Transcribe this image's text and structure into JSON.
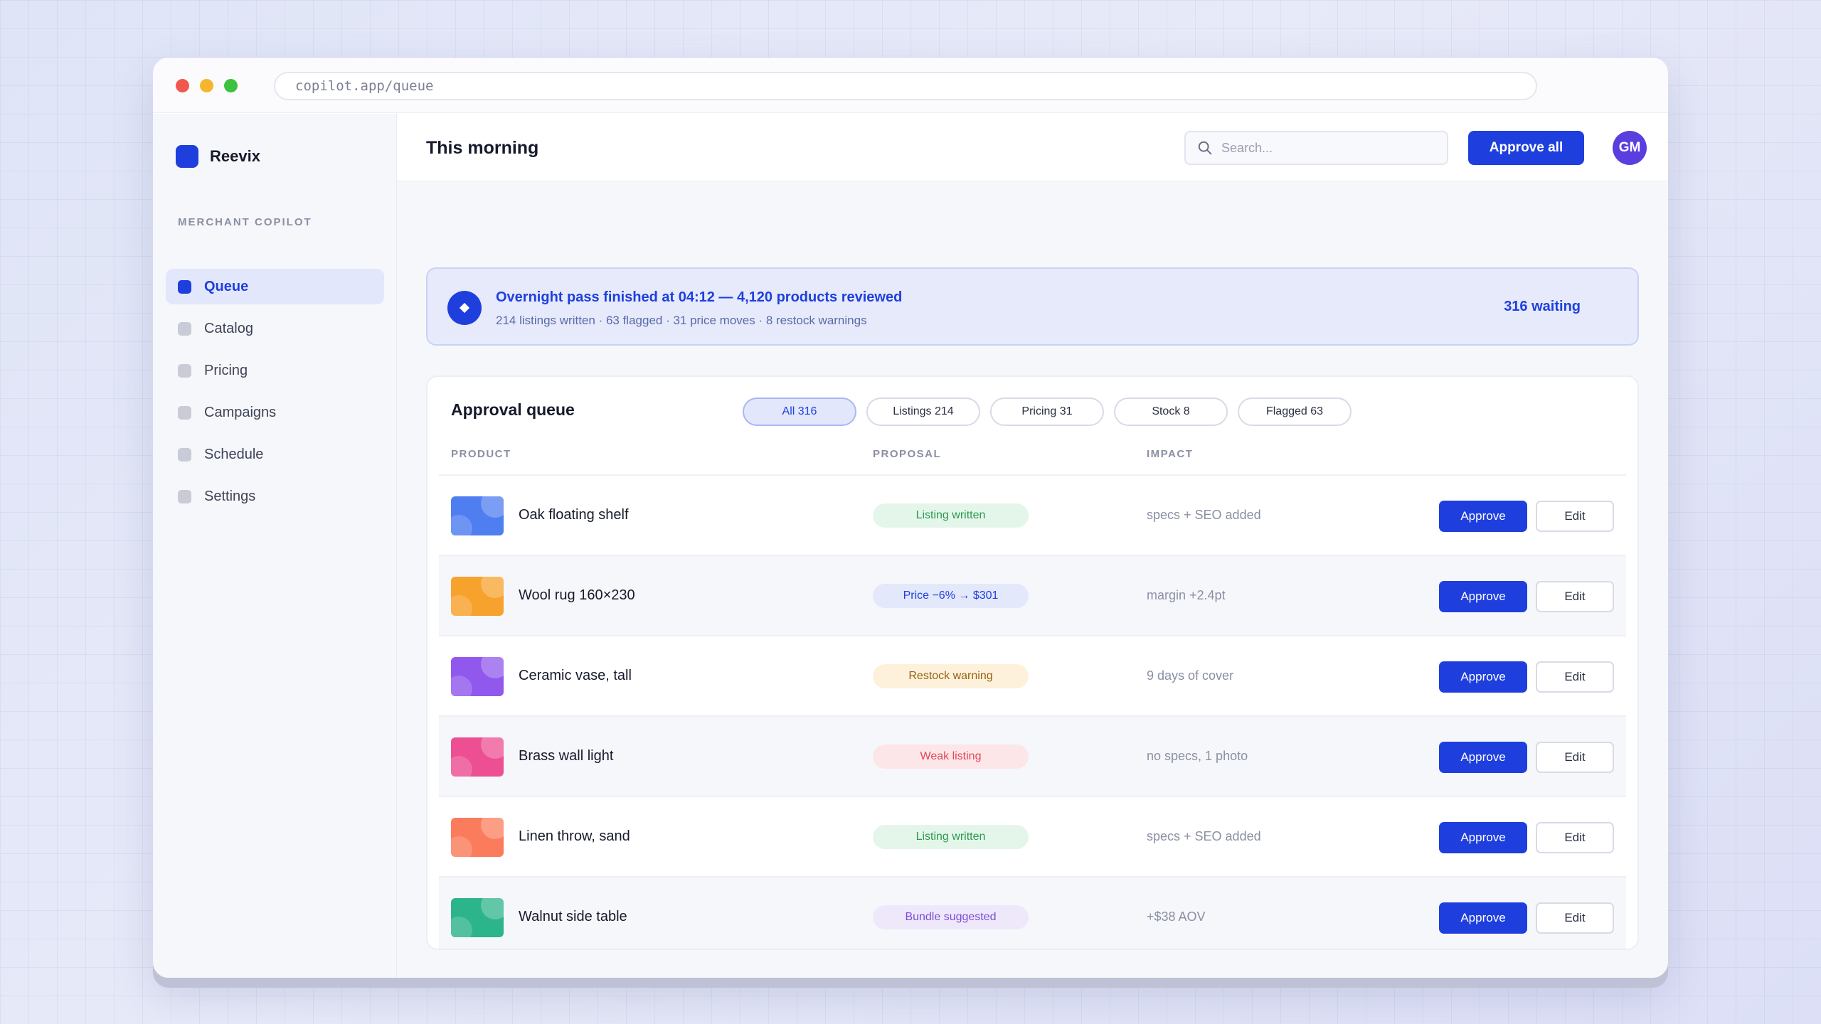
{
  "browser": {
    "url": "copilot.app/queue"
  },
  "brand": {
    "name": "Reevix",
    "color": "#1e3fde"
  },
  "sidebar": {
    "section_label": "MERCHANT COPILOT",
    "items": [
      {
        "label": "Queue",
        "active": true
      },
      {
        "label": "Catalog",
        "active": false
      },
      {
        "label": "Pricing",
        "active": false
      },
      {
        "label": "Campaigns",
        "active": false
      },
      {
        "label": "Schedule",
        "active": false
      },
      {
        "label": "Settings",
        "active": false
      }
    ]
  },
  "header": {
    "title": "This morning",
    "search_placeholder": "Search...",
    "approve_all_label": "Approve all",
    "avatar_initials": "GM"
  },
  "banner": {
    "title": "Overnight pass finished at 04:12 — 4,120 products reviewed",
    "subtitle": "214 listings written · 63 flagged · 31 price moves · 8 restock warnings",
    "waiting": "316 waiting"
  },
  "queue": {
    "title": "Approval queue",
    "filters": [
      {
        "label": "All 316",
        "active": true
      },
      {
        "label": "Listings 214",
        "active": false
      },
      {
        "label": "Pricing 31",
        "active": false
      },
      {
        "label": "Stock 8",
        "active": false
      },
      {
        "label": "Flagged 63",
        "active": false
      }
    ],
    "columns": [
      "PRODUCT",
      "PROPOSAL",
      "IMPACT"
    ],
    "approve_label": "Approve",
    "edit_label": "Edit",
    "rows": [
      {
        "product": "Oak floating shelf",
        "proposal": "Listing written",
        "proposal_kind": "green",
        "impact": "specs + SEO added",
        "thumb_color": "#4f7ef0"
      },
      {
        "product": "Wool rug 160×230",
        "proposal": "Price −6% → $301",
        "proposal_kind": "blue",
        "impact": "margin +2.4pt",
        "thumb_color": "#f7a22c"
      },
      {
        "product": "Ceramic vase, tall",
        "proposal": "Restock warning",
        "proposal_kind": "amber",
        "impact": "9 days of cover",
        "thumb_color": "#9058ec"
      },
      {
        "product": "Brass wall light",
        "proposal": "Weak listing",
        "proposal_kind": "red",
        "impact": "no specs, 1 photo",
        "thumb_color": "#ec4f92"
      },
      {
        "product": "Linen throw, sand",
        "proposal": "Listing written",
        "proposal_kind": "green",
        "impact": "specs + SEO added",
        "thumb_color": "#fb7c5c"
      },
      {
        "product": "Walnut side table",
        "proposal": "Bundle suggested",
        "proposal_kind": "purple",
        "impact": "+$38 AOV",
        "thumb_color": "#2cb48a"
      }
    ]
  },
  "pill_colors": {
    "green": {
      "bg": "#e4f6ea",
      "fg": "#2b9a4f"
    },
    "blue": {
      "bg": "#e3e8fb",
      "fg": "#1e3fde"
    },
    "amber": {
      "bg": "#fdf1dc",
      "fg": "#9a6212"
    },
    "red": {
      "bg": "#fde6e8",
      "fg": "#e0485a"
    },
    "purple": {
      "bg": "#efe8fb",
      "fg": "#7a4cd6"
    }
  }
}
